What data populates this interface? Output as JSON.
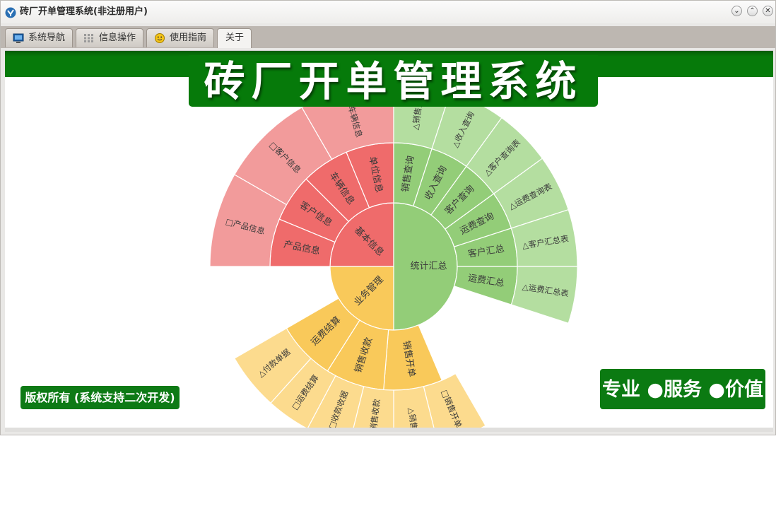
{
  "window": {
    "title": "砖厂开单管理系统(非注册用户)",
    "controls": [
      "minimize",
      "maximize",
      "close"
    ]
  },
  "tabs": [
    {
      "label": "系统导航",
      "icon": "monitor-icon"
    },
    {
      "label": "信息操作",
      "icon": "grid-icon"
    },
    {
      "label": "使用指南",
      "icon": "smiley-icon"
    },
    {
      "label": "关于",
      "icon": ""
    }
  ],
  "active_tab": "关于",
  "banner": {
    "title": "砖厂开单管理系统"
  },
  "footer": {
    "copyright": "版权所有 (系统支持二次开发)",
    "slogan": "专业 ●服务 ●价值"
  },
  "colors": {
    "brand_green": "#067a0a",
    "red": "#ef6b6b",
    "red_light": "#f29b9b",
    "green": "#93cd78",
    "green_light": "#b4dea0",
    "yellow": "#f9c95a",
    "yellow_light": "#fcdb8e"
  },
  "sunburst": {
    "categories": [
      {
        "name": "基本信息",
        "color": "red",
        "items": [
          {
            "name": "产品信息",
            "children": [
              "□产品信息"
            ]
          },
          {
            "name": "客户信息",
            "children": [
              "□客户信息"
            ]
          },
          {
            "name": "车辆信息",
            "children": [
              "□车辆信息"
            ]
          },
          {
            "name": "单位信息",
            "children": []
          }
        ]
      },
      {
        "name": "统计汇总",
        "color": "green",
        "items": [
          {
            "name": "销售查询",
            "children": [
              "△销售查"
            ]
          },
          {
            "name": "收入查询",
            "children": [
              "△收入查询"
            ]
          },
          {
            "name": "客户查询",
            "children": [
              "△客户查询表"
            ]
          },
          {
            "name": "运费查询",
            "children": [
              "△运费查询表"
            ]
          },
          {
            "name": "客户汇总",
            "children": [
              "△客户汇总表"
            ]
          },
          {
            "name": "运费汇总",
            "children": [
              "△运费汇总表"
            ]
          }
        ]
      },
      {
        "name": "业务管理",
        "color": "yellow",
        "items": [
          {
            "name": "销售开单",
            "children": [
              "□销售开单",
              "△销售"
            ]
          },
          {
            "name": "销售收款",
            "children": [
              "□销售收款",
              "□收款收据"
            ]
          },
          {
            "name": "运费结算",
            "children": [
              "□运费结算",
              "△付款单据"
            ]
          }
        ]
      }
    ]
  }
}
